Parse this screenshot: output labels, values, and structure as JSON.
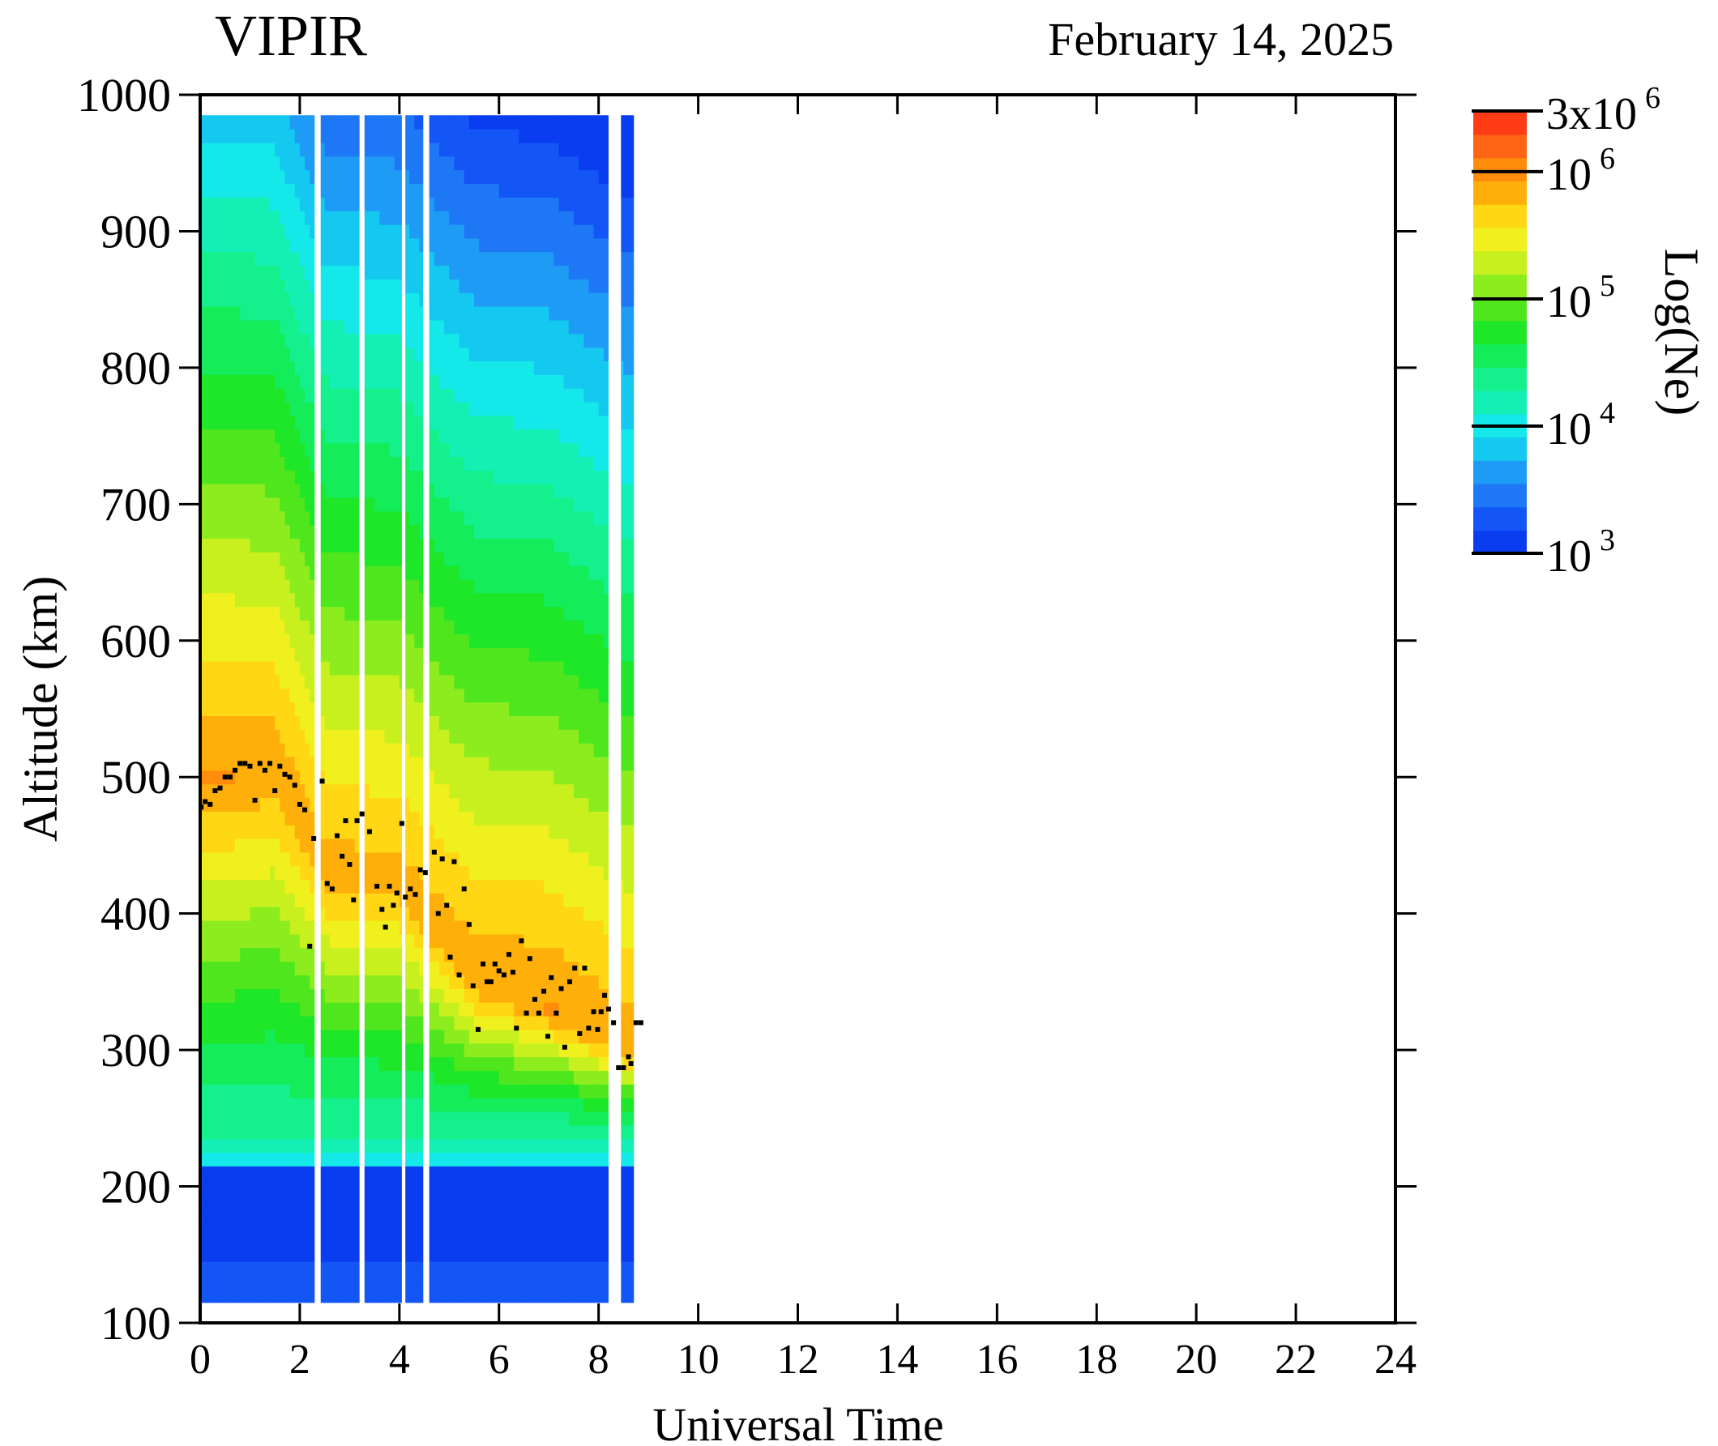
{
  "chart_data": {
    "type": "heatmap",
    "title": "VIPIR",
    "date": "February 14, 2025",
    "xlabel": "Universal Time",
    "ylabel": "Altitude (km)",
    "colorbar_label": "Log(Ne)",
    "xlim": [
      0,
      24
    ],
    "ylim": [
      100,
      1000
    ],
    "x_ticks": [
      "0",
      "2",
      "4",
      "6",
      "8",
      "10",
      "12",
      "14",
      "16",
      "18",
      "20",
      "22",
      "24"
    ],
    "y_ticks": [
      "100",
      "200",
      "300",
      "400",
      "500",
      "600",
      "700",
      "800",
      "900",
      "1000"
    ],
    "colorbar": {
      "scale": "log",
      "range": [
        1000,
        3000000
      ],
      "ticks": [
        {
          "value": 3000000,
          "base": "3x10",
          "exp": "6"
        },
        {
          "value": 1000000,
          "base": "10",
          "exp": "6"
        },
        {
          "value": 100000,
          "base": "10",
          "exp": "5"
        },
        {
          "value": 10000,
          "base": "10",
          "exp": "4"
        },
        {
          "value": 1000,
          "base": "10",
          "exp": "3"
        }
      ],
      "colors": [
        "#0a3cf0",
        "#1456f5",
        "#1e78f5",
        "#1e9cf5",
        "#14c8f0",
        "#14e8e8",
        "#14f0b4",
        "#14f08c",
        "#14ec5a",
        "#1ee628",
        "#50e61e",
        "#8cec1e",
        "#c8f01e",
        "#f0f01e",
        "#ffd714",
        "#ffaf0a",
        "#ff8c0a",
        "#ff6414",
        "#ff3c14"
      ]
    },
    "data_x_range": [
      0,
      8.7
    ],
    "data_alt_range": [
      115,
      985
    ],
    "gaps": [
      [
        2.3,
        2.42
      ],
      [
        3.2,
        3.3
      ],
      [
        4.05,
        4.12
      ],
      [
        4.48,
        4.6
      ],
      [
        8.2,
        8.45
      ]
    ],
    "density_profile_samples": [
      {
        "time": 0.5,
        "peak_alt": 500,
        "peak_log_ne": 5.95
      },
      {
        "time": 1.5,
        "peak_alt": 505,
        "peak_log_ne": 5.9
      },
      {
        "time": 2.5,
        "peak_alt": 430,
        "peak_log_ne": 5.85
      },
      {
        "time": 4.0,
        "peak_alt": 420,
        "peak_log_ne": 5.85
      },
      {
        "time": 5.5,
        "peak_alt": 350,
        "peak_log_ne": 5.9
      },
      {
        "time": 7.0,
        "peak_alt": 330,
        "peak_log_ne": 5.95
      },
      {
        "time": 8.5,
        "peak_alt": 300,
        "peak_log_ne": 5.9
      }
    ],
    "hmF2_points": [
      [
        0.02,
        478
      ],
      [
        0.1,
        482
      ],
      [
        0.2,
        480
      ],
      [
        0.3,
        490
      ],
      [
        0.4,
        492
      ],
      [
        0.5,
        500
      ],
      [
        0.6,
        500
      ],
      [
        0.7,
        505
      ],
      [
        0.8,
        510
      ],
      [
        0.9,
        510
      ],
      [
        1.0,
        508
      ],
      [
        1.1,
        483
      ],
      [
        1.2,
        510
      ],
      [
        1.3,
        505
      ],
      [
        1.4,
        510
      ],
      [
        1.5,
        490
      ],
      [
        1.6,
        508
      ],
      [
        1.7,
        502
      ],
      [
        1.8,
        500
      ],
      [
        1.9,
        494
      ],
      [
        2.0,
        480
      ],
      [
        2.1,
        476
      ],
      [
        2.2,
        376
      ],
      [
        2.28,
        455
      ],
      [
        2.45,
        497
      ],
      [
        2.55,
        422
      ],
      [
        2.65,
        418
      ],
      [
        2.75,
        457
      ],
      [
        2.85,
        442
      ],
      [
        2.92,
        468
      ],
      [
        3.0,
        436
      ],
      [
        3.08,
        410
      ],
      [
        3.15,
        468
      ],
      [
        3.25,
        473
      ],
      [
        3.4,
        460
      ],
      [
        3.55,
        420
      ],
      [
        3.65,
        403
      ],
      [
        3.72,
        390
      ],
      [
        3.8,
        420
      ],
      [
        3.88,
        406
      ],
      [
        3.95,
        415
      ],
      [
        4.05,
        466
      ],
      [
        4.12,
        412
      ],
      [
        4.22,
        418
      ],
      [
        4.32,
        414
      ],
      [
        4.42,
        432
      ],
      [
        4.52,
        430
      ],
      [
        4.7,
        445
      ],
      [
        4.78,
        400
      ],
      [
        4.86,
        440
      ],
      [
        4.95,
        406
      ],
      [
        5.02,
        368
      ],
      [
        5.1,
        438
      ],
      [
        5.2,
        355
      ],
      [
        5.3,
        418
      ],
      [
        5.4,
        392
      ],
      [
        5.48,
        347
      ],
      [
        5.58,
        315
      ],
      [
        5.68,
        363
      ],
      [
        5.76,
        350
      ],
      [
        5.84,
        350
      ],
      [
        5.92,
        363
      ],
      [
        6.0,
        358
      ],
      [
        6.1,
        355
      ],
      [
        6.2,
        370
      ],
      [
        6.28,
        357
      ],
      [
        6.35,
        316
      ],
      [
        6.45,
        380
      ],
      [
        6.55,
        327
      ],
      [
        6.62,
        367
      ],
      [
        6.72,
        337
      ],
      [
        6.8,
        327
      ],
      [
        6.9,
        343
      ],
      [
        6.98,
        310
      ],
      [
        7.05,
        353
      ],
      [
        7.15,
        327
      ],
      [
        7.25,
        345
      ],
      [
        7.32,
        302
      ],
      [
        7.42,
        350
      ],
      [
        7.52,
        360
      ],
      [
        7.62,
        312
      ],
      [
        7.72,
        360
      ],
      [
        7.8,
        316
      ],
      [
        7.9,
        328
      ],
      [
        7.98,
        315
      ],
      [
        8.05,
        328
      ],
      [
        8.12,
        340
      ],
      [
        8.2,
        330
      ],
      [
        8.3,
        320
      ],
      [
        8.4,
        287
      ],
      [
        8.5,
        287
      ],
      [
        8.6,
        295
      ],
      [
        8.65,
        290
      ],
      [
        8.75,
        320
      ],
      [
        8.85,
        320
      ]
    ]
  }
}
